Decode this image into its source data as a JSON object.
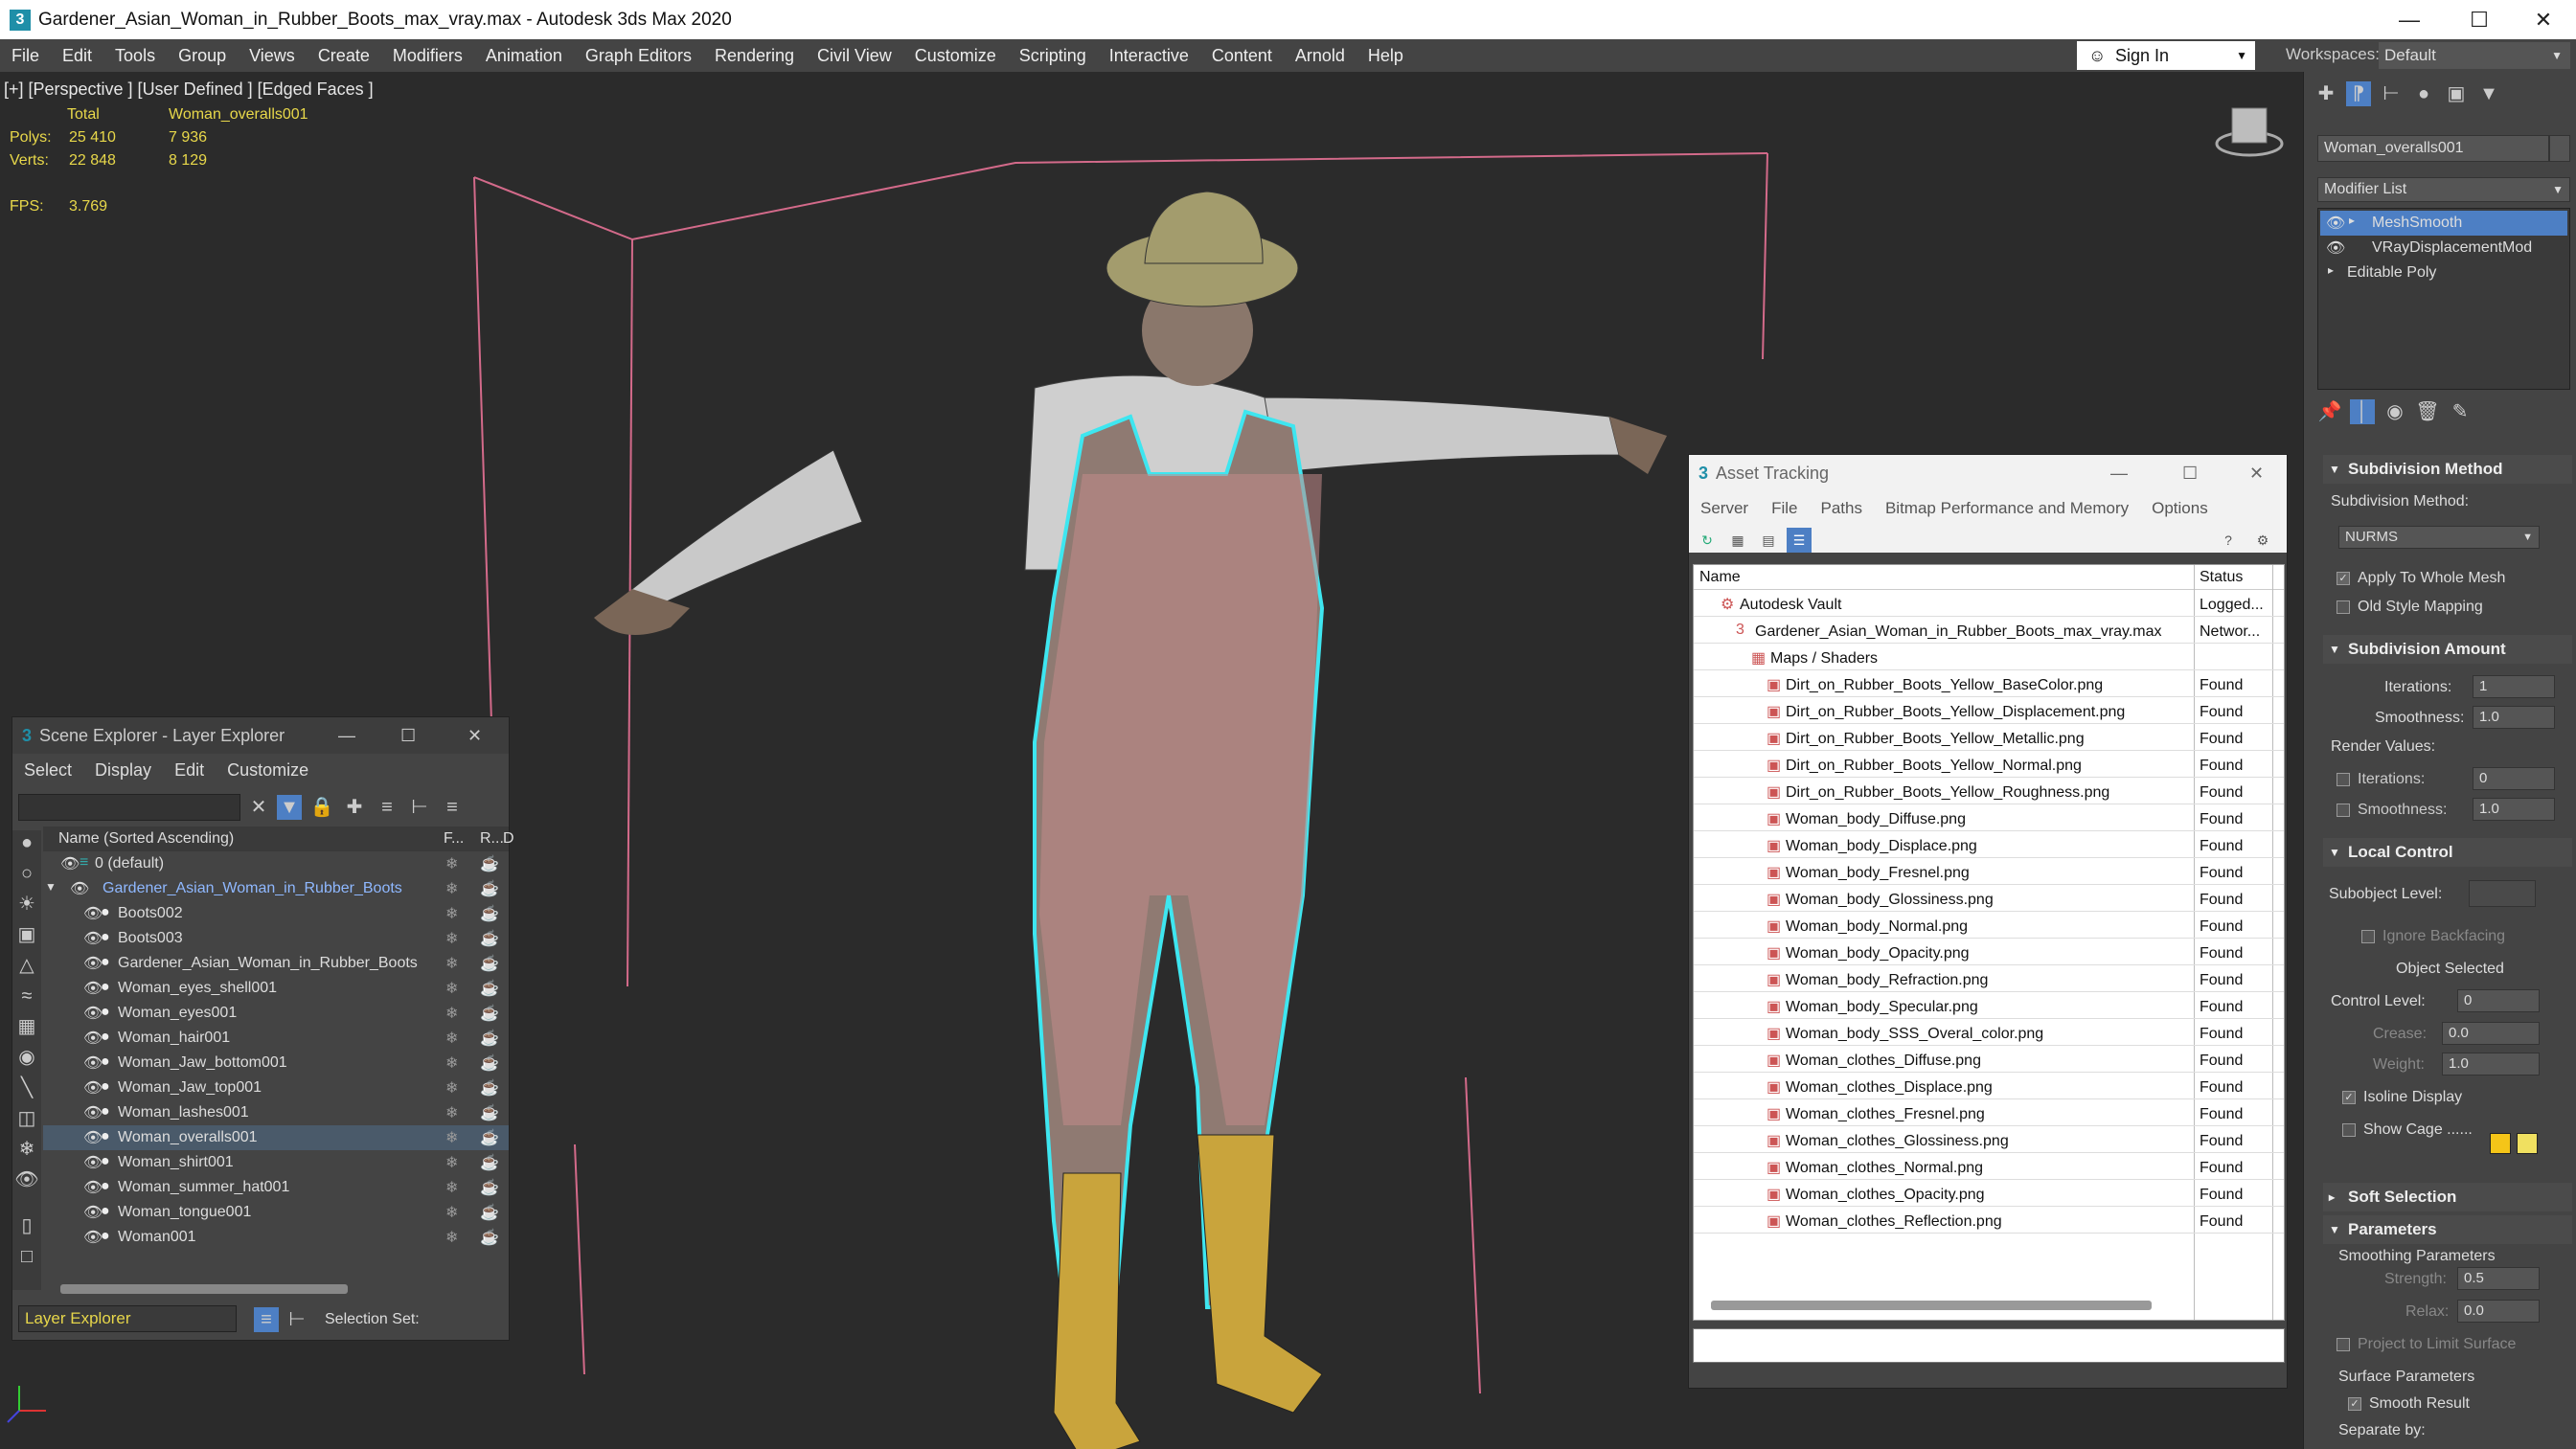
{
  "window": {
    "title": "Gardener_Asian_Woman_in_Rubber_Boots_max_vray.max - Autodesk 3ds Max 2020"
  },
  "menu": [
    "File",
    "Edit",
    "Tools",
    "Group",
    "Views",
    "Create",
    "Modifiers",
    "Animation",
    "Graph Editors",
    "Rendering",
    "Civil View",
    "Customize",
    "Scripting",
    "Interactive",
    "Content",
    "Arnold",
    "Help"
  ],
  "signin": "Sign In",
  "workspaces": {
    "label": "Workspaces:",
    "value": "Default"
  },
  "viewport": {
    "label": "[+] [Perspective ] [User Defined ] [Edged Faces ]",
    "stats": {
      "total": "Total",
      "object": "Woman_overalls001",
      "polys_label": "Polys:",
      "polys_total": "25 410",
      "polys_obj": "7 936",
      "verts_label": "Verts:",
      "verts_total": "22 848",
      "verts_obj": "8 129",
      "fps_label": "FPS:",
      "fps": "3.769"
    }
  },
  "scene_explorer": {
    "title": "Scene Explorer - Layer Explorer",
    "menu": [
      "Select",
      "Display",
      "Edit",
      "Customize"
    ],
    "col_name": "Name (Sorted Ascending)",
    "col_f": "F...",
    "col_r": "R...",
    "col_d": "D",
    "default_layer": "0 (default)",
    "group": "Gardener_Asian_Woman_in_Rubber_Boots",
    "items": [
      "Boots002",
      "Boots003",
      "Gardener_Asian_Woman_in_Rubber_Boots",
      "Woman_eyes_shell001",
      "Woman_eyes001",
      "Woman_hair001",
      "Woman_Jaw_bottom001",
      "Woman_Jaw_top001",
      "Woman_lashes001",
      "Woman_overalls001",
      "Woman_shirt001",
      "Woman_summer_hat001",
      "Woman_tongue001",
      "Woman001"
    ],
    "selected_item": "Woman_overalls001",
    "footer_mode": "Layer Explorer",
    "selection_set": "Selection Set:"
  },
  "asset_tracking": {
    "title": "Asset Tracking",
    "menu": [
      "Server",
      "File",
      "Paths",
      "Bitmap Performance and Memory",
      "Options"
    ],
    "col_name": "Name",
    "col_status": "Status",
    "vault": "Autodesk Vault",
    "vault_status": "Logged...",
    "file": "Gardener_Asian_Woman_in_Rubber_Boots_max_vray.max",
    "file_status": "Networ...",
    "maps": "Maps / Shaders",
    "assets": [
      "Dirt_on_Rubber_Boots_Yellow_BaseColor.png",
      "Dirt_on_Rubber_Boots_Yellow_Displacement.png",
      "Dirt_on_Rubber_Boots_Yellow_Metallic.png",
      "Dirt_on_Rubber_Boots_Yellow_Normal.png",
      "Dirt_on_Rubber_Boots_Yellow_Roughness.png",
      "Woman_body_Diffuse.png",
      "Woman_body_Displace.png",
      "Woman_body_Fresnel.png",
      "Woman_body_Glossiness.png",
      "Woman_body_Normal.png",
      "Woman_body_Opacity.png",
      "Woman_body_Refraction.png",
      "Woman_body_Specular.png",
      "Woman_body_SSS_Overal_color.png",
      "Woman_clothes_Diffuse.png",
      "Woman_clothes_Displace.png",
      "Woman_clothes_Fresnel.png",
      "Woman_clothes_Glossiness.png",
      "Woman_clothes_Normal.png",
      "Woman_clothes_Opacity.png",
      "Woman_clothes_Reflection.png"
    ],
    "asset_status": "Found"
  },
  "command_panel": {
    "object_name": "Woman_overalls001",
    "modifier_list": "Modifier List",
    "stack": [
      "MeshSmooth",
      "VRayDisplacementMod",
      "Editable Poly"
    ],
    "subdiv_method": {
      "title": "Subdivision Method",
      "label": "Subdivision Method:",
      "value": "NURMS",
      "apply_whole": "Apply To Whole Mesh",
      "old_style": "Old Style Mapping"
    },
    "subdiv_amount": {
      "title": "Subdivision Amount",
      "iterations_label": "Iterations:",
      "iterations": "1",
      "smoothness_label": "Smoothness:",
      "smoothness": "1.0",
      "render_values": "Render Values:",
      "r_iterations_label": "Iterations:",
      "r_iterations": "0",
      "r_smoothness_label": "Smoothness:",
      "r_smoothness": "1.0"
    },
    "local_control": {
      "title": "Local Control",
      "subobject": "Subobject Level:",
      "ignore_backfacing": "Ignore Backfacing",
      "object_selected": "Object Selected",
      "control_level_label": "Control Level:",
      "control_level": "0",
      "crease_label": "Crease:",
      "crease": "0.0",
      "weight_label": "Weight:",
      "weight": "1.0",
      "isoline": "Isoline Display",
      "show_cage": "Show Cage ......"
    },
    "soft_selection": "Soft Selection",
    "parameters": {
      "title": "Parameters",
      "smoothing": "Smoothing Parameters",
      "strength_label": "Strength:",
      "strength": "0.5",
      "relax_label": "Relax:",
      "relax": "0.0",
      "project": "Project to Limit Surface",
      "surface": "Surface Parameters",
      "smooth_result": "Smooth Result",
      "separate": "Separate by:"
    }
  },
  "colors": {
    "accent": "#4d7fc4",
    "cage1": "#f5c518",
    "cage2": "#f0e060",
    "selection": "#4a5a6a",
    "highlight_outline": "#3ee6f0"
  }
}
